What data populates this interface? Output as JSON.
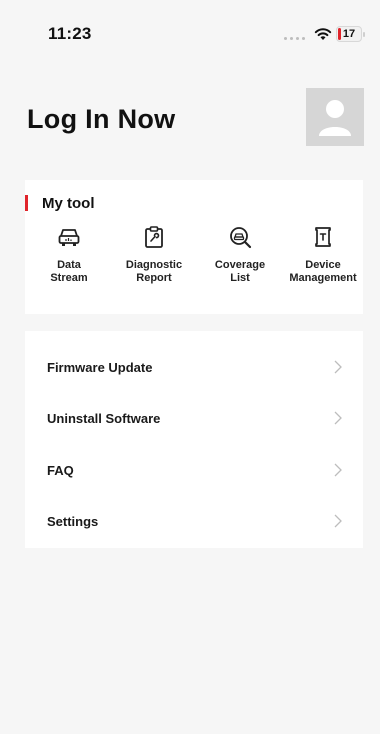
{
  "status_bar": {
    "time": "11:23",
    "battery": "17"
  },
  "header": {
    "title": "Log In Now"
  },
  "my_tool": {
    "title": "My tool",
    "items": [
      {
        "line1": "Data",
        "line2": "Stream",
        "icon": "car-data-icon"
      },
      {
        "line1": "Diagnostic",
        "line2": "Report",
        "icon": "report-clipboard-icon"
      },
      {
        "line1": "Coverage",
        "line2": "List",
        "icon": "search-car-icon"
      },
      {
        "line1": "Device",
        "line2": "Management",
        "icon": "device-icon"
      }
    ]
  },
  "menu": {
    "items": [
      {
        "label": "Firmware Update"
      },
      {
        "label": "Uninstall Software"
      },
      {
        "label": "FAQ"
      },
      {
        "label": "Settings"
      }
    ]
  },
  "colors": {
    "accent": "#e0242b",
    "background": "#f6f6f6",
    "card": "#ffffff"
  }
}
